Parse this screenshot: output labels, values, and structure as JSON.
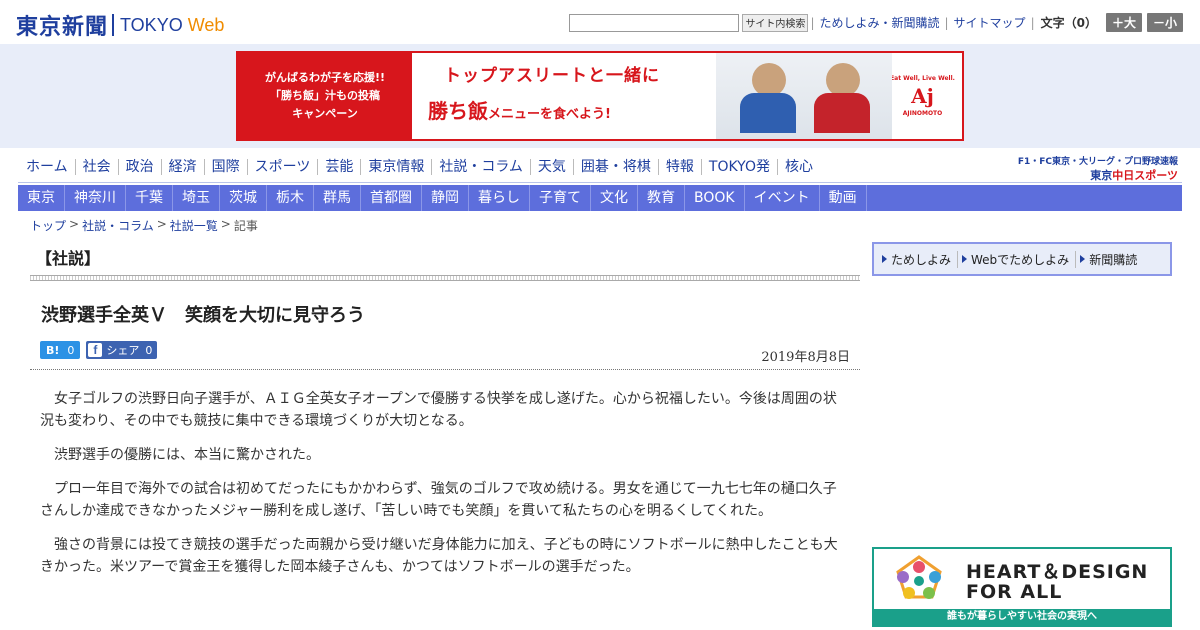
{
  "header": {
    "logo_kanji": "東京新聞",
    "logo_tokyo": "TOKYO",
    "logo_web": "Web",
    "search_button": "サイト内検索",
    "links": [
      "ためしよみ・新聞購読",
      "サイトマップ"
    ],
    "font_label": "文字（0）",
    "font_increase": "＋大",
    "font_decrease": "－小"
  },
  "ad": {
    "left_lines": [
      "がんばるわが子を応援!!",
      "「勝ち飯」汁もの投稿",
      "キャンペーン"
    ],
    "headline": "トップアスリートと一緒に",
    "sub_brand": "勝ち飯",
    "sub_rest": "メニューを食べよう!",
    "tagline": "Eat Well, Live Well.",
    "brand_mark": "Aj",
    "brand_name": "AJINOMOTO"
  },
  "nav": {
    "main": [
      "ホーム",
      "社会",
      "政治",
      "経済",
      "国際",
      "スポーツ",
      "芸能",
      "東京情報",
      "社説・コラム",
      "天気",
      "囲碁・将棋",
      "特報",
      "TOKYO発",
      "核心"
    ],
    "region": [
      "東京",
      "神奈川",
      "千葉",
      "埼玉",
      "茨城",
      "栃木",
      "群馬",
      "首都圏",
      "静岡",
      "暮らし",
      "子育て",
      "文化",
      "教育",
      "BOOK",
      "イベント",
      "動画"
    ],
    "sports_top": "F1・FC東京・大リーグ・プロ野球速報",
    "sports_prefix": "東京",
    "sports_brand": "中日スポーツ"
  },
  "breadcrumb": [
    "トップ",
    "社説・コラム",
    "社説一覧",
    "記事"
  ],
  "article": {
    "section": "【社説】",
    "title": "渋野選手全英Ｖ　笑顔を大切に見守ろう",
    "hatena_label": "B!",
    "hatena_count": "0",
    "fb_icon": "f",
    "fb_label": "シェア",
    "fb_count": "0",
    "date": "2019年8月8日",
    "paragraphs": [
      "女子ゴルフの渋野日向子選手が、ＡＩＧ全英女子オープンで優勝する快挙を成し遂げた。心から祝福したい。今後は周囲の状況も変わり、その中でも競技に集中できる環境づくりが大切となる。",
      "渋野選手の優勝には、本当に驚かされた。",
      "プロ一年目で海外での試合は初めてだったにもかかわらず、強気のゴルフで攻め続ける。男女を通じて一九七七年の樋口久子さんしか達成できなかったメジャー勝利を成し遂げ、「苦しい時でも笑顔」を貫いて私たちの心を明るくしてくれた。",
      "強さの背景には投てき競技の選手だった両親から受け継いだ身体能力に加え、子どもの時にソフトボールに熱中したことも大きかった。米ツアーで賞金王を獲得した岡本綾子さんも、かつてはソフトボールの選手だった。"
    ]
  },
  "sidebar": {
    "subscribe": [
      "ためしよみ",
      "Webでためしよみ",
      "新聞購読"
    ],
    "banner_line1": "HEART＆DESIGN",
    "banner_line2": "FOR ALL",
    "banner_caption": "誰もが暮らしやすい社会の実現へ"
  },
  "colors": {
    "brand_blue": "#1f3f9e",
    "nav_band": "#5d6edc",
    "ad_red": "#d7161c",
    "web_orange": "#f08c00",
    "banner_teal": "#1aa08a"
  }
}
